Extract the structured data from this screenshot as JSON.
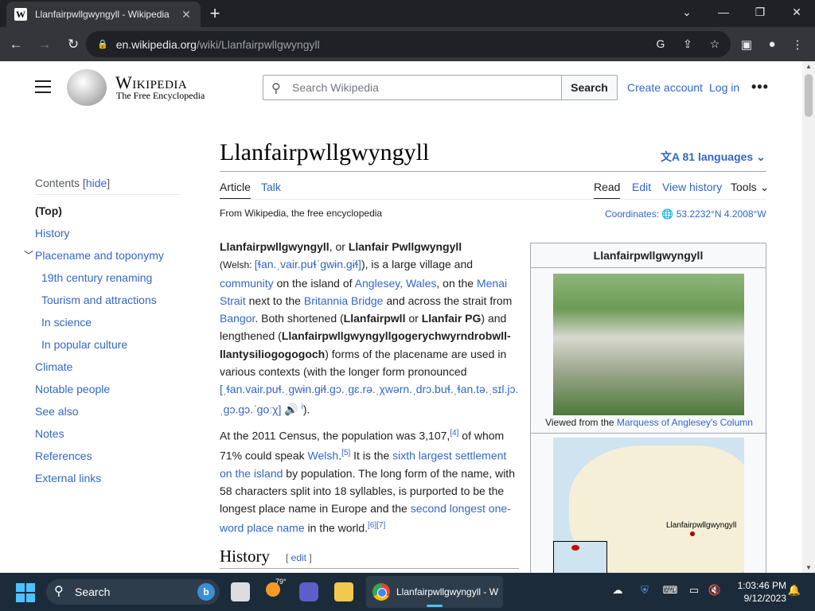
{
  "browser": {
    "tab_title": "Llanfairpwllgwyngyll - Wikipedia",
    "favicon_letter": "W",
    "url_host": "en.wikipedia.org",
    "url_path": "/wiki/Llanfairpwllgwyngyll"
  },
  "header": {
    "logo_word": "Wikipedia",
    "logo_tagline": "The Free Encyclopedia",
    "search_placeholder": "Search Wikipedia",
    "search_button": "Search",
    "create_account": "Create account",
    "log_in": "Log in"
  },
  "toc": {
    "heading": "Contents",
    "hide": "hide",
    "items": [
      {
        "label": "(Top)"
      },
      {
        "label": "History"
      },
      {
        "label": "Placename and toponymy"
      },
      {
        "label": "19th century renaming"
      },
      {
        "label": "Tourism and attractions"
      },
      {
        "label": "In science"
      },
      {
        "label": "In popular culture"
      },
      {
        "label": "Climate"
      },
      {
        "label": "Notable people"
      },
      {
        "label": "See also"
      },
      {
        "label": "Notes"
      },
      {
        "label": "References"
      },
      {
        "label": "External links"
      }
    ]
  },
  "article": {
    "title": "Llanfairpwllgwyngyll",
    "languages": "81 languages",
    "tabs": {
      "article": "Article",
      "talk": "Talk",
      "read": "Read",
      "edit": "Edit",
      "view_history": "View history",
      "tools": "Tools"
    },
    "from_wp": "From Wikipedia, the free encyclopedia",
    "coordinates_label": "Coordinates:",
    "coordinates_value": "53.2232°N 4.2008°W",
    "section_heading": "History",
    "section_edit": "edit"
  },
  "infobox": {
    "title": "Llanfairpwllgwyngyll",
    "caption_prefix": "Viewed from the ",
    "caption_link": "Marquess of Anglesey's Column",
    "map_label": "Llanfairpwllgwyngyll"
  },
  "taskbar": {
    "search": "Search",
    "temperature": "79°",
    "chrome_label": "Llanfairpwllgwyngyll - W",
    "time": "1:03:46 PM",
    "date": "9/12/2023"
  }
}
